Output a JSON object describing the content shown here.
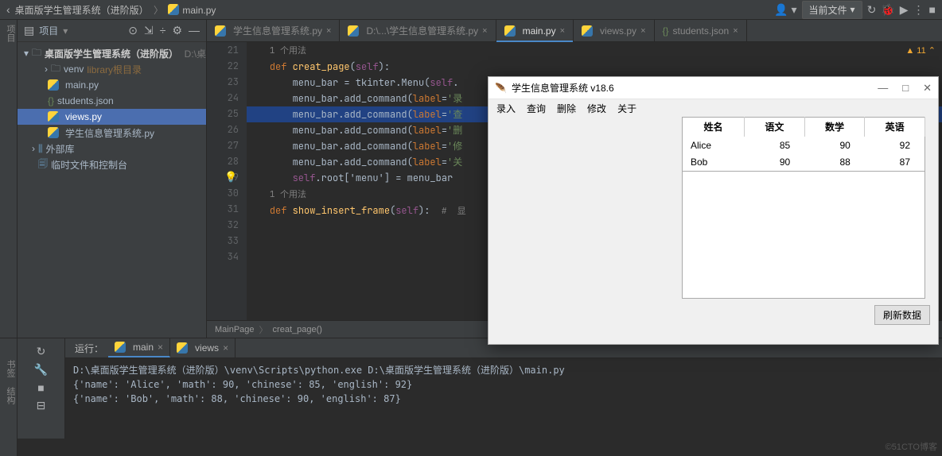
{
  "breadcrumb": {
    "project": "桌面版学生管理系统（进阶版）",
    "file": "main.py"
  },
  "top_right": {
    "current_file": "当前文件"
  },
  "project_panel": {
    "title": "项目",
    "root": "桌面版学生管理系统（进阶版）",
    "root_path": "D:\\桌",
    "items": [
      {
        "label": "venv",
        "suffix": "library根目录",
        "indent": 34,
        "type": "folder",
        "expandable": true
      },
      {
        "label": "main.py",
        "indent": 38,
        "type": "py"
      },
      {
        "label": "students.json",
        "indent": 38,
        "type": "json"
      },
      {
        "label": "views.py",
        "indent": 38,
        "type": "py",
        "selected": true
      },
      {
        "label": "学生信息管理系统.py",
        "indent": 38,
        "type": "py"
      },
      {
        "label": "外部库",
        "indent": 18,
        "type": "lib",
        "expandable": true
      },
      {
        "label": "临时文件和控制台",
        "indent": 26,
        "type": "scratch"
      }
    ]
  },
  "tabs": [
    {
      "label": "学生信息管理系统.py",
      "active": false
    },
    {
      "label": "D:\\...\\学生信息管理系统.py",
      "active": false
    },
    {
      "label": "main.py",
      "active": true
    },
    {
      "label": "views.py",
      "active": false
    },
    {
      "label": "students.json",
      "active": false
    }
  ],
  "gutter_lines": [
    "21",
    "22",
    "23",
    "",
    "24",
    "25",
    "26",
    "27",
    "28",
    "29",
    "30",
    "31",
    "32",
    "33",
    "",
    "34"
  ],
  "code": {
    "usage_hint": "1 个用法",
    "def_creat": "creat_page",
    "menu_assign": "menu_bar = tkinter.Menu(",
    "add_cmd": "menu_bar.add_command(",
    "labels": [
      "录",
      "查",
      "删",
      "修",
      "关"
    ],
    "root_menu": "['menu'] = menu_bar",
    "def_show": "show_insert_frame",
    "comment_tail": "#  显"
  },
  "crumb_bar": {
    "a": "MainPage",
    "b": "creat_page()"
  },
  "warnings": "11",
  "run_label": "运行：",
  "run_tabs": [
    {
      "label": "main",
      "active": true
    },
    {
      "label": "views",
      "active": false
    }
  ],
  "console_lines": [
    "D:\\桌面版学生管理系统（进阶版）\\venv\\Scripts\\python.exe D:\\桌面版学生管理系统（进阶版）\\main.py",
    "{'name': 'Alice', 'math': 90, 'chinese': 85, 'english': 92}",
    "{'name': 'Bob', 'math': 88, 'chinese': 90, 'english': 87}"
  ],
  "tk": {
    "title": "学生信息管理系统 v18.6",
    "menu": [
      "录入",
      "查询",
      "删除",
      "修改",
      "关于"
    ],
    "headers": [
      "姓名",
      "语文",
      "数学",
      "英语"
    ],
    "rows": [
      {
        "name": "Alice",
        "chinese": 85,
        "math": 90,
        "english": 92
      },
      {
        "name": "Bob",
        "chinese": 90,
        "math": 88,
        "english": 87
      }
    ],
    "refresh": "刷新数据"
  },
  "side_tabs": {
    "project": "项目",
    "bookmarks": "书签",
    "structure": "结构"
  },
  "footer": "©51CTO博客"
}
